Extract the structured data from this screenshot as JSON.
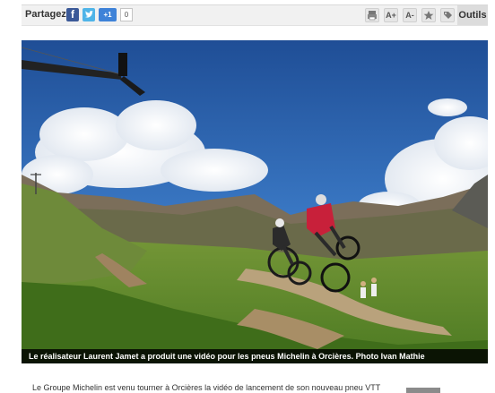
{
  "share": {
    "label": "Partagez",
    "facebook_letter": "f",
    "gplus_label": "+1",
    "count": "0"
  },
  "tools": {
    "label": "Outils",
    "increase_font_label": "A+",
    "decrease_font_label": "A-",
    "items": [
      "print-icon",
      "text-larger-icon",
      "text-smaller-icon",
      "favorite-icon",
      "tag-icon"
    ]
  },
  "photo": {
    "caption": "Le réalisateur Laurent Jamet a produit une vidéo pour les pneus Michelin à Orcières. Photo Ivan Mathie"
  },
  "article": {
    "first_line": "Le Groupe Michelin est venu tourner à Orcières la vidéo de lancement de son nouveau pneu VTT"
  },
  "colors": {
    "facebook": "#3b5998",
    "twitter": "#4fb4e8",
    "gplus": "#3e82d8",
    "caption_bg": "#000000"
  }
}
